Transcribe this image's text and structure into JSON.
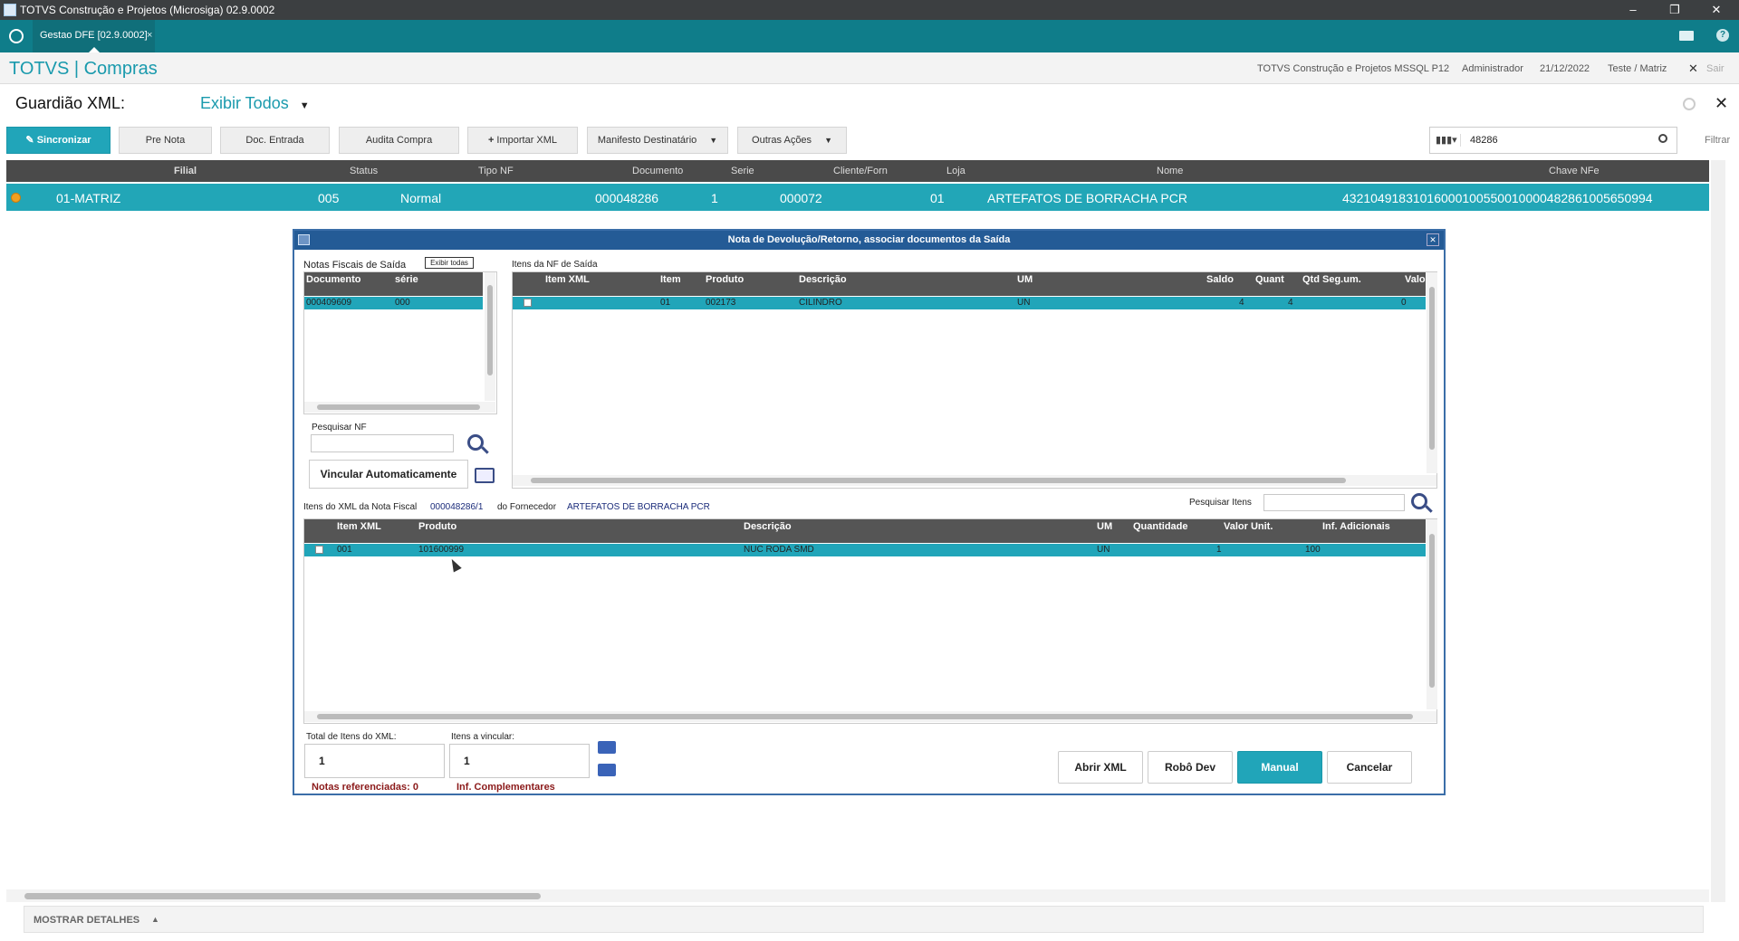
{
  "window": {
    "title": "TOTVS Construção e Projetos (Microsiga) 02.9.0002",
    "minimize": "–",
    "restore": "❐",
    "close": "✕"
  },
  "tabbar": {
    "tab_label": "Gestao DFE [02.9.0002]",
    "tab_close": "×",
    "mail_icon": "mail-icon",
    "help_icon": "help-icon"
  },
  "header": {
    "brand": "TOTVS | Compras",
    "company": "TOTVS Construção e Projetos MSSQL P12",
    "user": "Administrador",
    "date": "21/12/2022",
    "branch": "Teste / Matriz",
    "exit": "Sair"
  },
  "page": {
    "title": "Guardião XML:",
    "filter": "Exibir Todos",
    "close": "✕"
  },
  "toolbar": {
    "sincronizar": "Sincronizar",
    "pre_nota": "Pre Nota",
    "doc_entrada": "Doc. Entrada",
    "audita_compra": "Audita Compra",
    "importar_xml": "Importar XML",
    "manifesto": "Manifesto Destinatário",
    "outras_acoes": "Outras Ações",
    "search_value": "48286",
    "filtrar": "Filtrar"
  },
  "main_grid": {
    "headers": [
      "Filial",
      "Status",
      "Tipo NF",
      "Documento",
      "Serie",
      "Cliente/Forn",
      "Loja",
      "Nome",
      "Chave NFe"
    ],
    "row": [
      "01-MATRIZ",
      "005",
      "Normal",
      "000048286",
      "1",
      "000072",
      "01",
      "ARTEFATOS DE BORRACHA PCR",
      "43210491831016000100550010000482861005650994"
    ]
  },
  "dialog": {
    "title": "Nota de Devolução/Retorno, associar documentos da Saída",
    "nf_saida_label": "Notas Fiscais de Saída",
    "exibir_todas": "Exibir todas",
    "nf_headers": [
      "Documento",
      "série"
    ],
    "nf_row": [
      "000409609",
      "000"
    ],
    "itens_saida_label": "Itens da NF de Saída",
    "itens_headers": [
      "Item XML",
      "Item",
      "Produto",
      "Descrição",
      "UM",
      "Saldo",
      "Quant",
      "Qtd Seg.um.",
      "Valo"
    ],
    "itens_row": [
      "",
      "01",
      "002173",
      "CILINDRO",
      "UN",
      "4",
      "4",
      "0",
      ""
    ],
    "pesquisar_nf": "Pesquisar NF",
    "vincular": "Vincular Automaticamente",
    "xml_label": "Itens do XML da Nota Fiscal",
    "xml_nf": "000048286/1",
    "fornecedor_label": "do Fornecedor",
    "fornecedor": "ARTEFATOS DE BORRACHA PCR",
    "pesquisar_itens": "Pesquisar Itens",
    "xml_headers": [
      "Item XML",
      "Produto",
      "Descrição",
      "UM",
      "Quantidade",
      "Valor Unit.",
      "Inf. Adicionais"
    ],
    "xml_row": [
      "001",
      "101600999",
      "NUC RODA SMD",
      "UN",
      "1",
      "100",
      ""
    ],
    "total_label": "Total de Itens do XML:",
    "total_value": "1",
    "vincular_label": "Itens a vincular:",
    "vincular_value": "1",
    "notas_ref": "Notas referenciadas: 0",
    "inf_compl": "Inf. Complementares",
    "buttons": {
      "abrir_xml": "Abrir XML",
      "robo_dev": "Robô Dev",
      "manual": "Manual",
      "cancelar": "Cancelar"
    }
  },
  "footer": {
    "mostrar_detalhes": "MOSTRAR DETALHES"
  },
  "colors": {
    "teal": "#21a5b9",
    "dark_teal": "#0f7d8a",
    "dialog_title": "#245b96"
  }
}
